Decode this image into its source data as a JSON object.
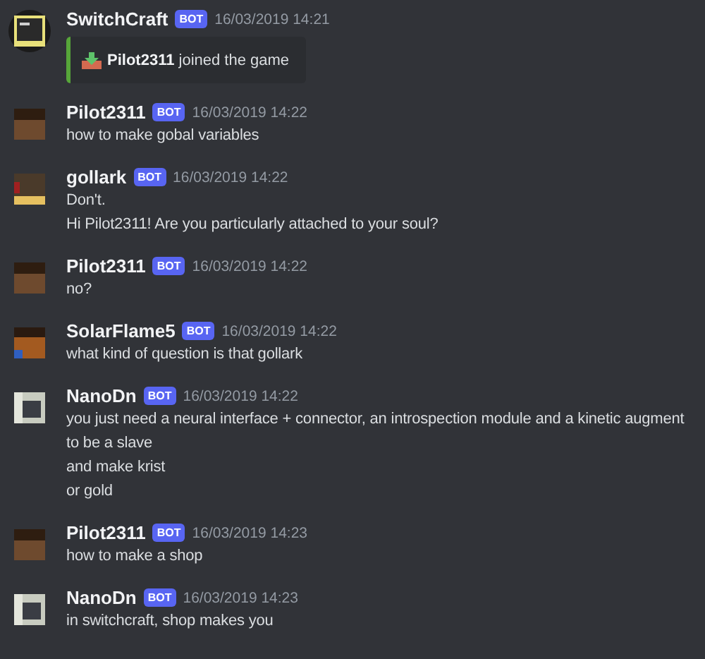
{
  "messages": [
    {
      "author": "SwitchCraft",
      "avatar": {
        "kind": "terminal"
      },
      "badge": "BOT",
      "time": "16/03/2019 14:21",
      "embed": {
        "text": "**Pilot2311** joined the game"
      }
    },
    {
      "author": "Pilot2311",
      "avatar": {
        "kind": "dark"
      },
      "badge": "BOT",
      "time": "16/03/2019 14:22",
      "lines": [
        "how to make gobal variables"
      ]
    },
    {
      "author": "gollark",
      "avatar": {
        "kind": "gold"
      },
      "badge": "BOT",
      "time": "16/03/2019 14:22",
      "lines": [
        "Don't.",
        "Hi Pilot2311! Are you particularly attached to your soul?"
      ]
    },
    {
      "author": "Pilot2311",
      "avatar": {
        "kind": "dark"
      },
      "badge": "BOT",
      "time": "16/03/2019 14:22",
      "lines": [
        "no?"
      ]
    },
    {
      "author": "SolarFlame5",
      "avatar": {
        "kind": "orange"
      },
      "badge": "BOT",
      "time": "16/03/2019 14:22",
      "lines": [
        "what kind of question is that gollark"
      ]
    },
    {
      "author": "NanoDn",
      "avatar": {
        "kind": "robot"
      },
      "badge": "BOT",
      "time": "16/03/2019 14:22",
      "lines": [
        "you just need a neural interface + connector, an introspection module and a kinetic augment",
        "to be a slave",
        "and make krist",
        "or gold"
      ]
    },
    {
      "author": "Pilot2311",
      "avatar": {
        "kind": "dark"
      },
      "badge": "BOT",
      "time": "16/03/2019 14:23",
      "lines": [
        "how to make a shop"
      ]
    },
    {
      "author": "NanoDn",
      "avatar": {
        "kind": "robot"
      },
      "badge": "BOT",
      "time": "16/03/2019 14:23",
      "lines": [
        "in switchcraft, shop makes you"
      ]
    }
  ]
}
